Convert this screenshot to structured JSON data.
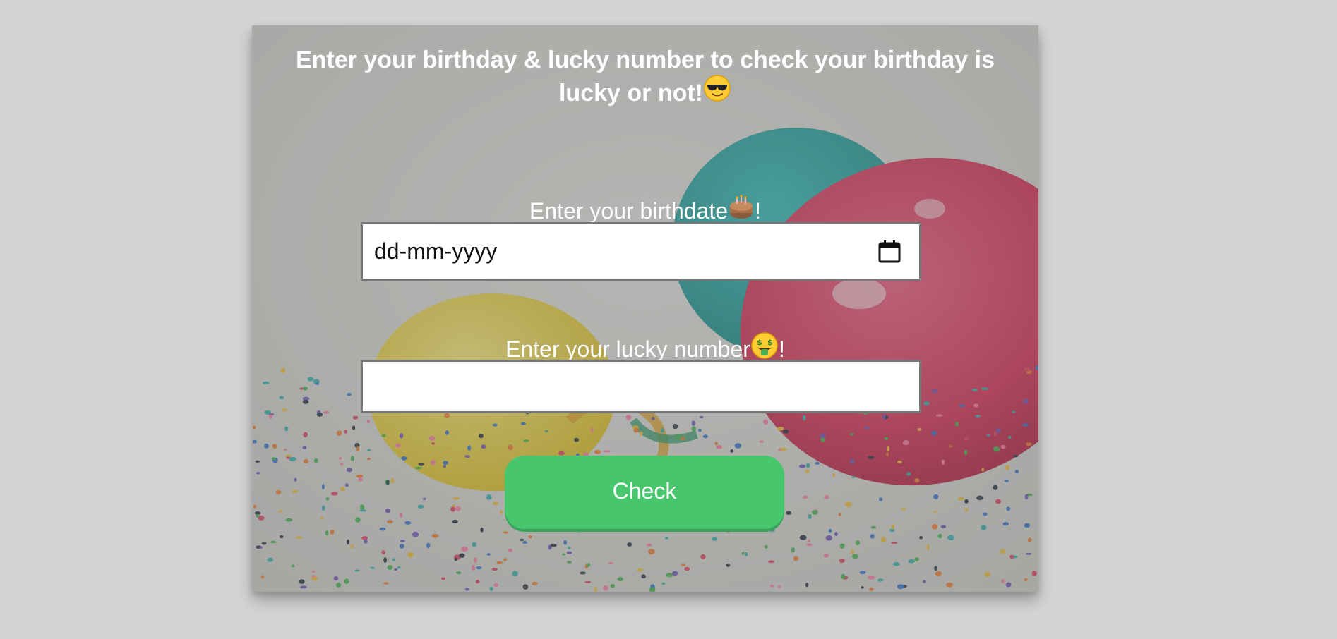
{
  "heading": {
    "line1": "Enter your birthday & lucky number to check your birthday is",
    "line2": "lucky or not!",
    "emoji_icon": "sunglasses-smiley-icon"
  },
  "birthdate": {
    "label": "Enter your birthdate",
    "label_suffix": "!",
    "emoji_icon": "birthday-cake-icon",
    "placeholder": "dd-mm-yyyy",
    "picker_icon": "calendar-icon"
  },
  "lucky_number": {
    "label": "Enter your lucky number",
    "label_suffix": "!",
    "emoji_icon": "money-mouth-face-icon",
    "value": ""
  },
  "check_button": {
    "label": "Check"
  },
  "colors": {
    "page_background": "#d4d4d4",
    "button": "#48c66e",
    "text": "#ffffff",
    "input_border": "#767676"
  },
  "background_image": "party-balloons-and-confetti"
}
